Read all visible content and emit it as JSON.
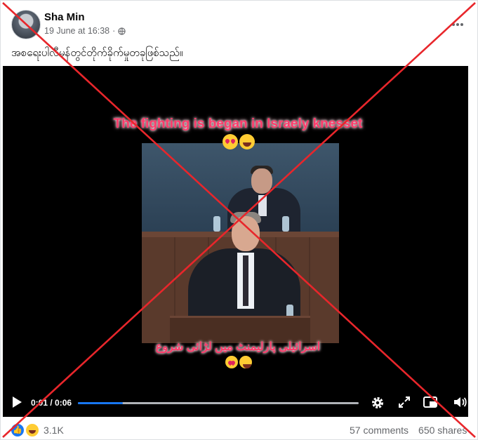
{
  "post": {
    "author": "Sha Min",
    "timestamp": "19 June at 16:38",
    "separator": "·",
    "caption": "အစရေးပါလီမန်တွင်တိုက်ခိုက်မှုတခုဖြစ်သည်။",
    "more_icon": "more-horizontal-icon"
  },
  "video": {
    "overlay_top": "The fighting is began in Israely knesset",
    "overlay_bottom": "اسرائیلی پارلیمنٹ میں لڑائی شروع",
    "time": "0:01 / 0:06",
    "progress": 0.16
  },
  "footer": {
    "reaction_count": "3.1K",
    "comments": "57 comments",
    "shares": "650 shares"
  },
  "colors": {
    "accent": "#1877f2",
    "cross": "#e8262b",
    "overlay_text": "#ff3b6b"
  }
}
